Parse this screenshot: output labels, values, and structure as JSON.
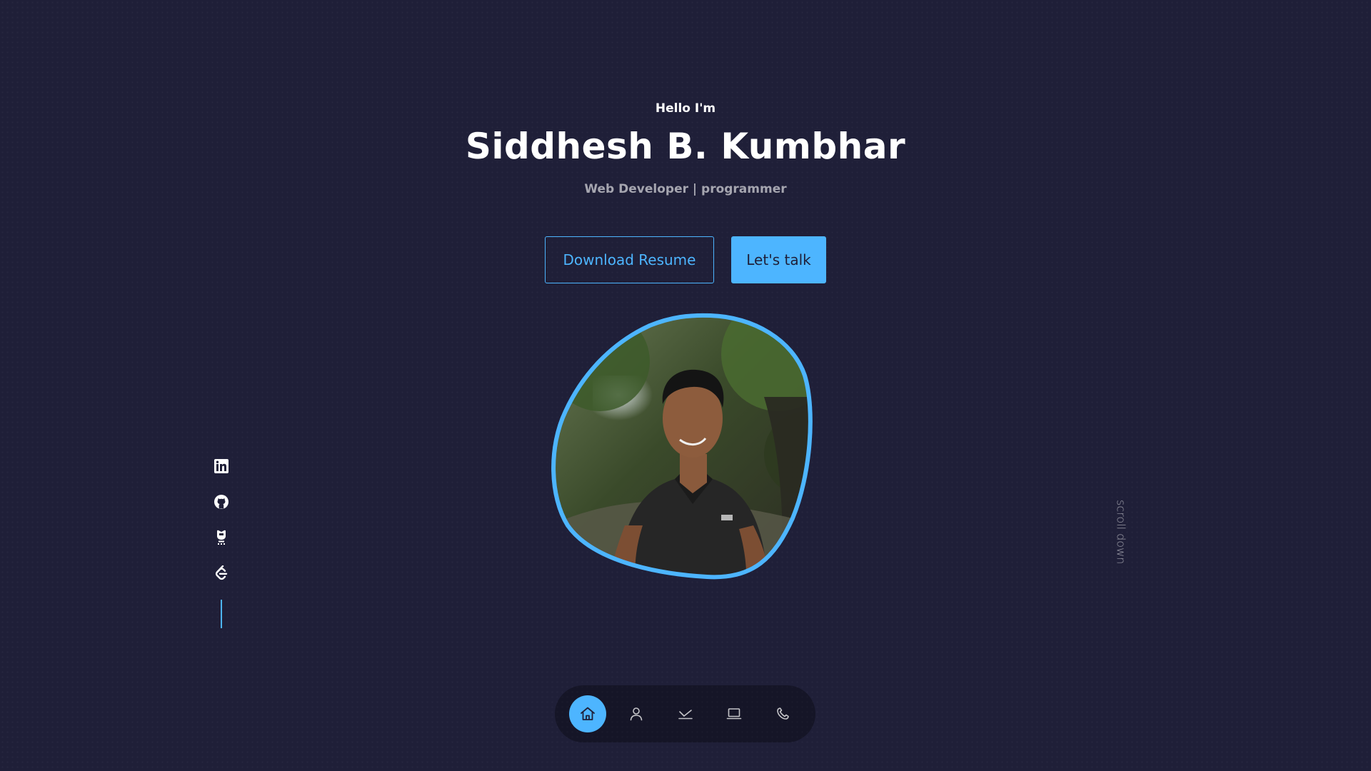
{
  "hero": {
    "greeting": "Hello I'm",
    "name": "Siddhesh B. Kumbhar",
    "role": "Web Developer | programmer",
    "download_label": "Download Resume",
    "talk_label": "Let's talk",
    "photo_alt": "profile photo"
  },
  "socials": [
    {
      "name": "linkedin-icon"
    },
    {
      "name": "github-icon"
    },
    {
      "name": "hackerrank-icon"
    },
    {
      "name": "leetcode-icon"
    }
  ],
  "scroll": {
    "label": "scroll down"
  },
  "nav": {
    "items": [
      {
        "icon": "home-icon",
        "active": true
      },
      {
        "icon": "user-icon",
        "active": false
      },
      {
        "icon": "experience-icon",
        "active": false
      },
      {
        "icon": "laptop-icon",
        "active": false
      },
      {
        "icon": "phone-icon",
        "active": false
      }
    ]
  },
  "colors": {
    "background": "#1f1f38",
    "accent": "#4db5ff",
    "text": "#ffffff",
    "text_muted": "rgba(255,255,255,0.6)"
  }
}
